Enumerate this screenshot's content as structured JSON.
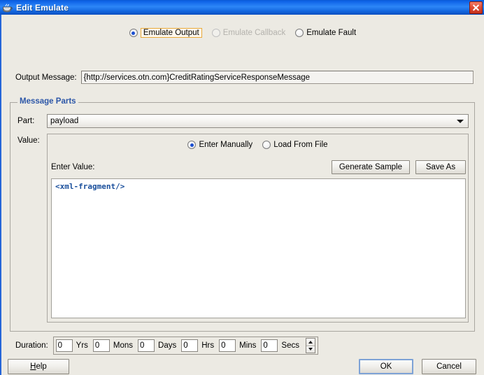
{
  "window": {
    "title": "Edit Emulate",
    "icon": "java-cup-icon",
    "close_label": "×",
    "titlebar_color": "#1468e0",
    "accent_color": "#2566d8"
  },
  "mode_radios": [
    {
      "label": "Emulate Output",
      "selected": true,
      "disabled": false,
      "focused": true
    },
    {
      "label": "Emulate Callback",
      "selected": false,
      "disabled": true,
      "focused": false
    },
    {
      "label": "Emulate Fault",
      "selected": false,
      "disabled": false,
      "focused": false
    }
  ],
  "output_message": {
    "label": "Output Message:",
    "value": "{http://services.otn.com}CreditRatingServiceResponseMessage"
  },
  "message_parts": {
    "group_title": "Message Parts",
    "group_title_color": "#2d57a8",
    "part": {
      "label": "Part:",
      "selected": "payload",
      "options": [
        "payload"
      ]
    },
    "value": {
      "label": "Value:",
      "source_radios": [
        {
          "label": "Enter Manually",
          "selected": true
        },
        {
          "label": "Load From File",
          "selected": false
        }
      ],
      "enter_value_label": "Enter Value:",
      "generate_sample_label": "Generate Sample",
      "save_as_label": "Save As",
      "editor_text": "<xml-fragment/>",
      "editor_text_color": "#1a4f9c"
    }
  },
  "duration": {
    "label": "Duration:",
    "fields": [
      {
        "value": "0",
        "unit": "Yrs"
      },
      {
        "value": "0",
        "unit": "Mons"
      },
      {
        "value": "0",
        "unit": "Days"
      },
      {
        "value": "0",
        "unit": "Hrs"
      },
      {
        "value": "0",
        "unit": "Mins"
      },
      {
        "value": "0",
        "unit": "Secs"
      }
    ]
  },
  "footer": {
    "help_label": "Help",
    "help_mnemonic": "H",
    "ok_label": "OK",
    "cancel_label": "Cancel"
  }
}
